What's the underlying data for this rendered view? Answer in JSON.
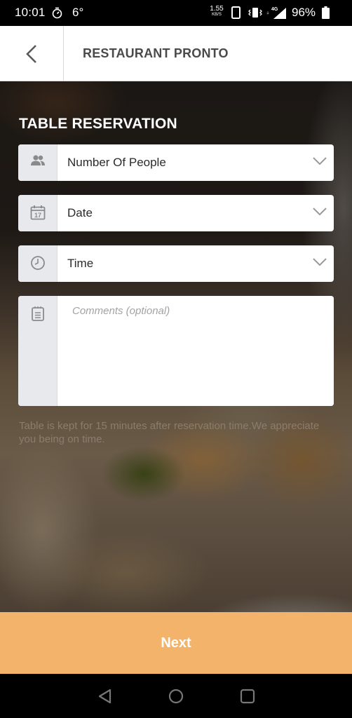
{
  "status_bar": {
    "time": "10:01",
    "temperature": "6°",
    "net_speed_value": "1.55",
    "net_speed_unit": "KB/S",
    "network_type": "4G",
    "battery_percent": "96%",
    "icons": [
      "timer-icon",
      "phone-icon",
      "vibrate-icon",
      "signal-icon",
      "battery-icon"
    ]
  },
  "header": {
    "back_icon": "chevron-left-icon",
    "title": "RESTAURANT PRONTO"
  },
  "form": {
    "section_title": "TABLE RESERVATION",
    "fields": [
      {
        "icon": "people-icon",
        "label": "Number Of People",
        "type": "dropdown"
      },
      {
        "icon": "calendar-icon",
        "label": "Date",
        "type": "dropdown",
        "icon_text": "17"
      },
      {
        "icon": "clock-icon",
        "label": "Time",
        "type": "dropdown"
      }
    ],
    "comments": {
      "icon": "notepad-icon",
      "placeholder": "Comments (optional)",
      "value": ""
    },
    "note": "Table is kept for 15 minutes after reservation time.We appreciate you being on time."
  },
  "next_button": {
    "label": "Next",
    "color": "#f4b36a"
  },
  "nav_bar": {
    "buttons": [
      "back-triangle-icon",
      "home-circle-icon",
      "recents-square-icon"
    ]
  }
}
